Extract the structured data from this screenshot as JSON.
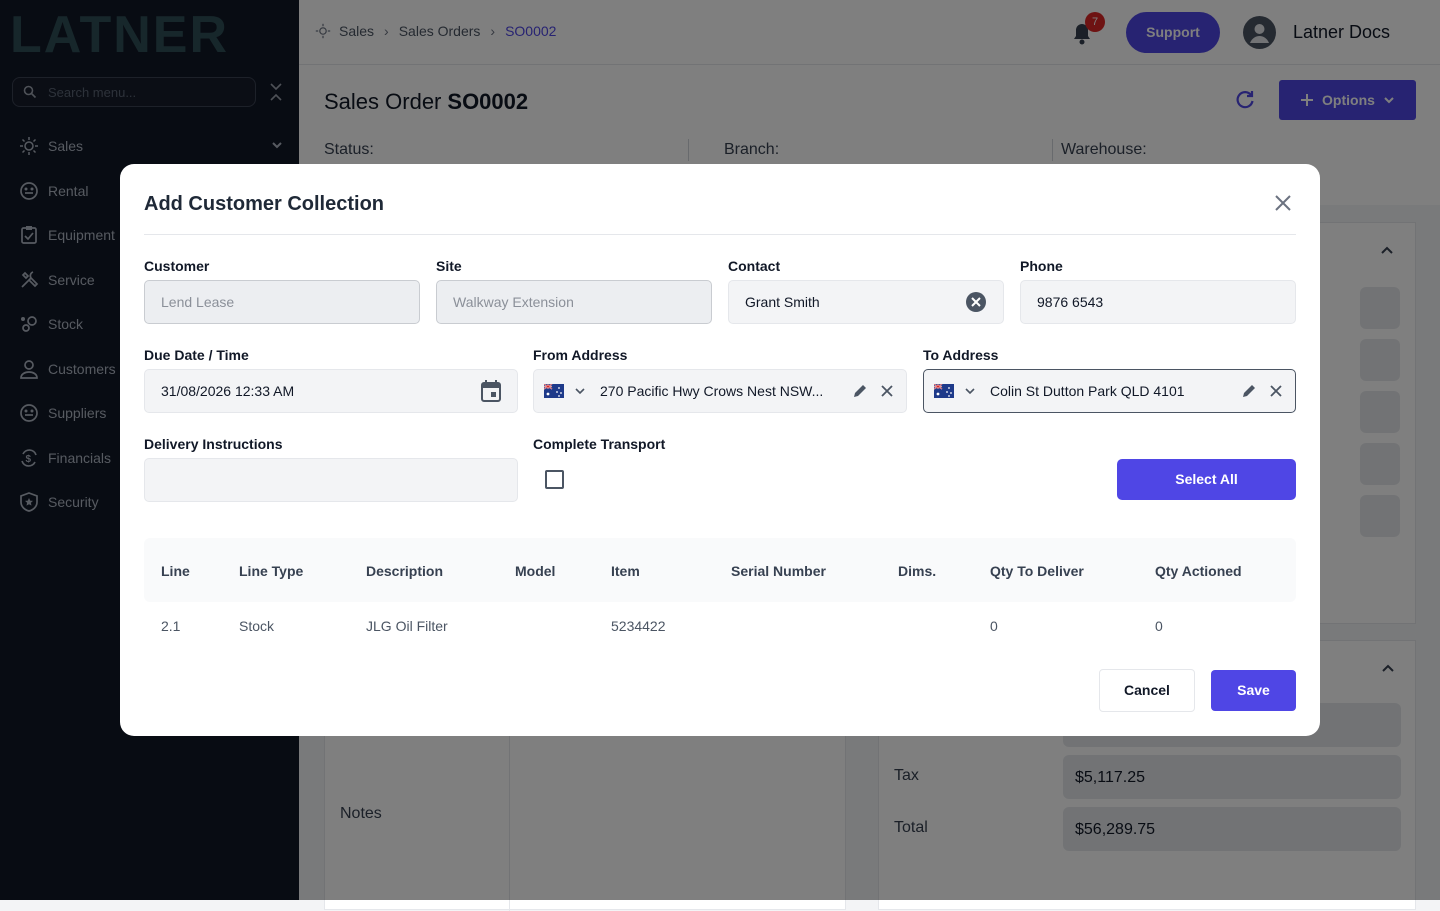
{
  "app": {
    "logo_text": "LATNER"
  },
  "sidebar": {
    "search_placeholder": "Search menu...",
    "items": [
      {
        "label": "Sales"
      },
      {
        "label": "Rental"
      },
      {
        "label": "Equipment"
      },
      {
        "label": "Service"
      },
      {
        "label": "Stock"
      },
      {
        "label": "Customers"
      },
      {
        "label": "Suppliers"
      },
      {
        "label": "Financials"
      },
      {
        "label": "Security"
      }
    ]
  },
  "topbar": {
    "breadcrumb": [
      "Sales",
      "Sales Orders",
      "SO0002"
    ],
    "notification_count": "7",
    "support_label": "Support",
    "user_name": "Latner Docs"
  },
  "page": {
    "title_prefix": "Sales Order",
    "title_id": "SO0002",
    "options_label": "Options",
    "status_label": "Status:",
    "branch_label": "Branch:",
    "warehouse_label": "Warehouse:",
    "notes_label": "Notes",
    "tax_label": "Tax",
    "tax_value": "$5,117.25",
    "total_label": "Total",
    "total_value": "$56,289.75"
  },
  "modal": {
    "title": "Add Customer Collection",
    "customer": {
      "label": "Customer",
      "value": "Lend Lease"
    },
    "site": {
      "label": "Site",
      "value": "Walkway Extension"
    },
    "contact": {
      "label": "Contact",
      "value": "Grant Smith"
    },
    "phone": {
      "label": "Phone",
      "value": "9876 6543"
    },
    "due": {
      "label": "Due Date / Time",
      "value": "31/08/2026 12:33 AM"
    },
    "from_address": {
      "label": "From Address",
      "value": "270 Pacific Hwy Crows Nest NSW..."
    },
    "to_address": {
      "label": "To Address",
      "value": "Colin St Dutton Park QLD 4101"
    },
    "delivery_instructions": {
      "label": "Delivery Instructions",
      "value": ""
    },
    "complete_transport": {
      "label": "Complete Transport",
      "checked": false
    },
    "select_all_label": "Select All",
    "table": {
      "headers": [
        "Line",
        "Line Type",
        "Description",
        "Model",
        "Item",
        "Serial Number",
        "Dims.",
        "Qty To Deliver",
        "Qty Actioned"
      ],
      "rows": [
        [
          "2.1",
          "Stock",
          "JLG Oil Filter",
          "",
          "5234422",
          "",
          "",
          "0",
          "0"
        ]
      ]
    },
    "cancel_label": "Cancel",
    "save_label": "Save"
  },
  "colors": {
    "accent": "#4f46e5",
    "sidebar_bg": "#111827",
    "badge": "#dc2626"
  }
}
